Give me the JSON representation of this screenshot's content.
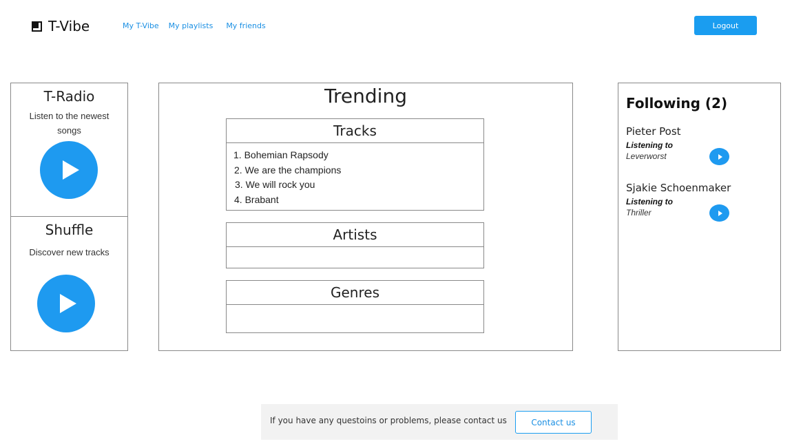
{
  "header": {
    "logo_text": "T-Vibe",
    "nav": [
      {
        "label": "My T-Vibe"
      },
      {
        "label": "My playlists"
      },
      {
        "label": "My  friends"
      }
    ],
    "logout_label": "Logout"
  },
  "left": {
    "radio": {
      "title": "T-Radio",
      "description": "Listen to the newest songs",
      "icon": "play-icon"
    },
    "shuffle": {
      "title": "Shuffle",
      "description": "Discover new tracks",
      "icon": "play-icon"
    }
  },
  "trending": {
    "title": "Trending",
    "tracks": {
      "heading": "Tracks",
      "items": [
        "1. Bohemian Rapsody",
        "2. We are the champions",
        "3. We will rock you",
        "4. Brabant"
      ]
    },
    "artists": {
      "heading": "Artists"
    },
    "genres": {
      "heading": "Genres"
    }
  },
  "following": {
    "title": "Following (2)",
    "friends": [
      {
        "name": "Pieter Post",
        "status_label": "Listening to",
        "track": "Leverworst"
      },
      {
        "name": "Sjakie Schoenmaker",
        "status_label": "Listening to",
        "track": "Thriller"
      }
    ]
  },
  "footer": {
    "text": "If you have any questoins or problems, please contact us",
    "contact_label": "Contact us"
  },
  "colors": {
    "accent": "#1a9df0",
    "border": "#888888",
    "footer_bg": "#f2f2f2"
  }
}
